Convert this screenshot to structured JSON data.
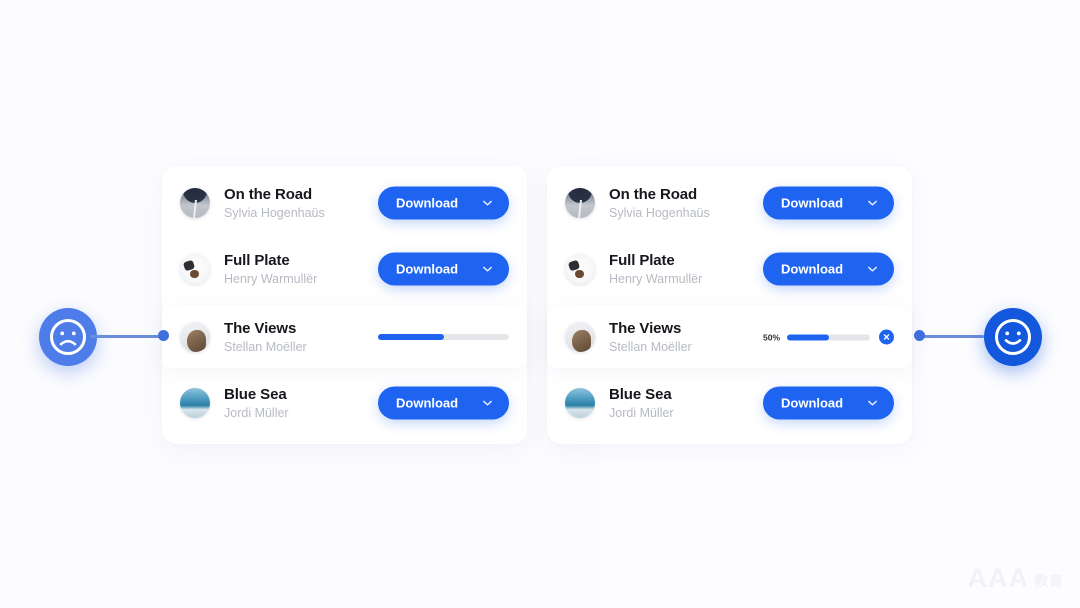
{
  "background": {
    "page_color": "#fdfdfe",
    "accent_blue": "#1f64f0",
    "sad_face_blue": "#4e7ce8",
    "happy_face_blue": "#1357dd"
  },
  "panels": [
    {
      "id": "before",
      "face": {
        "icon": "sad-face-icon",
        "mood": "sad"
      },
      "items": [
        {
          "title": "On the Road",
          "author": "Sylvia Hogenhaüs",
          "action": "button",
          "action_label": "Download",
          "avatar": "road-photo"
        },
        {
          "title": "Full Plate",
          "author": "Henry Warmullër",
          "action": "button",
          "action_label": "Download",
          "avatar": "plate-photo"
        },
        {
          "title": "The Views",
          "author": "Stellan Moëller",
          "action": "progress",
          "progress": 50,
          "progress_label": "",
          "avatar": "views-photo"
        },
        {
          "title": "Blue Sea",
          "author": "Jordi Müller",
          "action": "button",
          "action_label": "Download",
          "avatar": "sea-photo"
        }
      ]
    },
    {
      "id": "after",
      "face": {
        "icon": "happy-face-icon",
        "mood": "happy"
      },
      "items": [
        {
          "title": "On the Road",
          "author": "Sylvia Hogenhaüs",
          "action": "button",
          "action_label": "Download",
          "avatar": "road-photo"
        },
        {
          "title": "Full Plate",
          "author": "Henry Warmullër",
          "action": "button",
          "action_label": "Download",
          "avatar": "plate-photo"
        },
        {
          "title": "The Views",
          "author": "Stellan Moëller",
          "action": "progress",
          "progress": 50,
          "progress_label": "50%",
          "cancel_label": "×",
          "avatar": "views-photo"
        },
        {
          "title": "Blue Sea",
          "author": "Jordi Müller",
          "action": "button",
          "action_label": "Download",
          "avatar": "sea-photo"
        }
      ]
    }
  ],
  "watermark": {
    "text": "AAA",
    "sub": "教育"
  }
}
